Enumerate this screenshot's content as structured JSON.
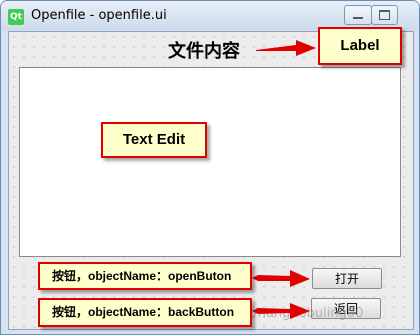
{
  "window": {
    "title": "Openfile - openfile.ui",
    "app_icon": "Qt"
  },
  "form": {
    "label_text": "文件内容",
    "open_button": "打开",
    "back_button": "返回"
  },
  "annotations": {
    "label": "Label",
    "text_edit": "Text Edit",
    "open_button": "按钮，objectName：openButon",
    "back_button": "按钮，objectName：backButton"
  },
  "watermark": "net/nanguobuling00",
  "colors": {
    "annotation_border": "#e00000",
    "annotation_fill": "#ffffcc",
    "arrow": "#e00000"
  }
}
